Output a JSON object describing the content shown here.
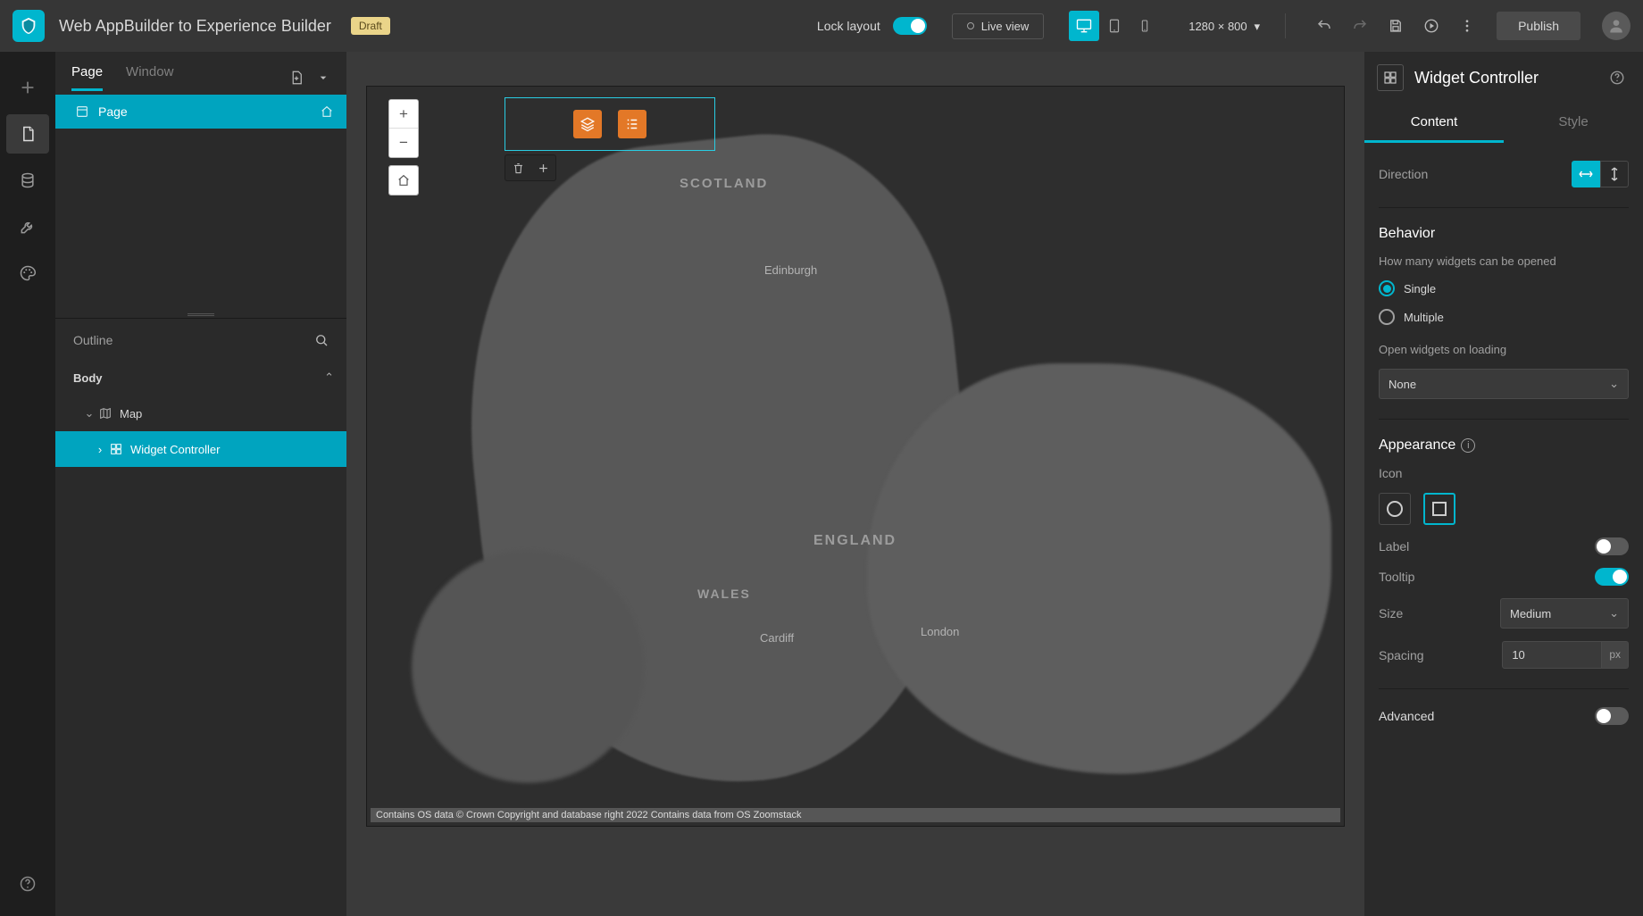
{
  "header": {
    "app_title": "Web AppBuilder to Experience Builder",
    "draft_badge": "Draft",
    "lock_layout_label": "Lock layout",
    "lock_layout_on": true,
    "live_view_label": "Live view",
    "resolution": "1280 × 800",
    "publish_label": "Publish"
  },
  "left_panel": {
    "tabs": {
      "page": "Page",
      "window": "Window"
    },
    "active_tab": "page",
    "pages": [
      {
        "label": "Page",
        "selected": true,
        "is_home": true
      }
    ],
    "outline_title": "Outline",
    "outline": {
      "body_label": "Body",
      "map_label": "Map",
      "widget_controller_label": "Widget Controller"
    }
  },
  "canvas": {
    "map_labels": {
      "scotland": "SCOTLAND",
      "england": "ENGLAND",
      "wales": "WALES",
      "edinburgh": "Edinburgh",
      "cardiff": "Cardiff",
      "london": "London"
    },
    "attribution": "Contains OS data © Crown Copyright and database right 2022 Contains data from OS Zoomstack"
  },
  "right_panel": {
    "title": "Widget Controller",
    "tabs": {
      "content": "Content",
      "style": "Style"
    },
    "active_tab": "content",
    "direction_label": "Direction",
    "direction": "horizontal",
    "behavior_title": "Behavior",
    "open_count_label": "How many widgets can be opened",
    "radio_single": "Single",
    "radio_multiple": "Multiple",
    "open_mode": "single",
    "open_on_load_label": "Open widgets on loading",
    "open_on_load_value": "None",
    "appearance_title": "Appearance",
    "icon_label": "Icon",
    "icon_shape": "square",
    "label_label": "Label",
    "label_on": false,
    "tooltip_label": "Tooltip",
    "tooltip_on": true,
    "size_label": "Size",
    "size_value": "Medium",
    "spacing_label": "Spacing",
    "spacing_value": "10",
    "spacing_unit": "px",
    "advanced_label": "Advanced",
    "advanced_on": false
  }
}
